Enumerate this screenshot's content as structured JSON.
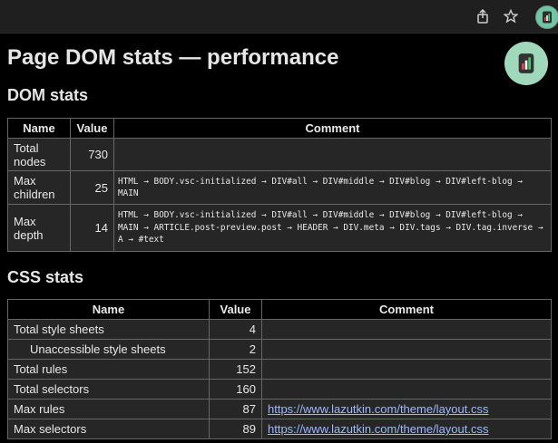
{
  "browser": {
    "share_icon": "share-icon",
    "bookmark_icon": "star-icon",
    "extension_icon": "extension-icon"
  },
  "page": {
    "title": "Page DOM stats — performance"
  },
  "dom_stats": {
    "heading": "DOM stats",
    "columns": [
      "Name",
      "Value",
      "Comment"
    ],
    "rows": [
      {
        "name": "Total nodes",
        "value": "730",
        "comment": ""
      },
      {
        "name": "Max children",
        "value": "25",
        "comment": "HTML → BODY.vsc-initialized → DIV#all → DIV#middle → DIV#blog → DIV#left-blog → MAIN"
      },
      {
        "name": "Max depth",
        "value": "14",
        "comment": "HTML → BODY.vsc-initialized → DIV#all → DIV#middle → DIV#blog → DIV#left-blog → MAIN → ARTICLE.post-preview.post → HEADER → DIV.meta → DIV.tags → DIV.tag.inverse → A → #text"
      }
    ]
  },
  "css_stats": {
    "heading": "CSS stats",
    "columns": [
      "Name",
      "Value",
      "Comment"
    ],
    "rows": [
      {
        "name": "Total style sheets",
        "value": "4",
        "comment": ""
      },
      {
        "name": "Unaccessible style sheets",
        "value": "2",
        "comment": ""
      },
      {
        "name": "Total rules",
        "value": "152",
        "comment": ""
      },
      {
        "name": "Total selectors",
        "value": "160",
        "comment": ""
      },
      {
        "name": "Max rules",
        "value": "87",
        "comment": "https://www.lazutkin.com/theme/layout.css"
      },
      {
        "name": "Max selectors",
        "value": "89",
        "comment": "https://www.lazutkin.com/theme/layout.css"
      }
    ]
  }
}
